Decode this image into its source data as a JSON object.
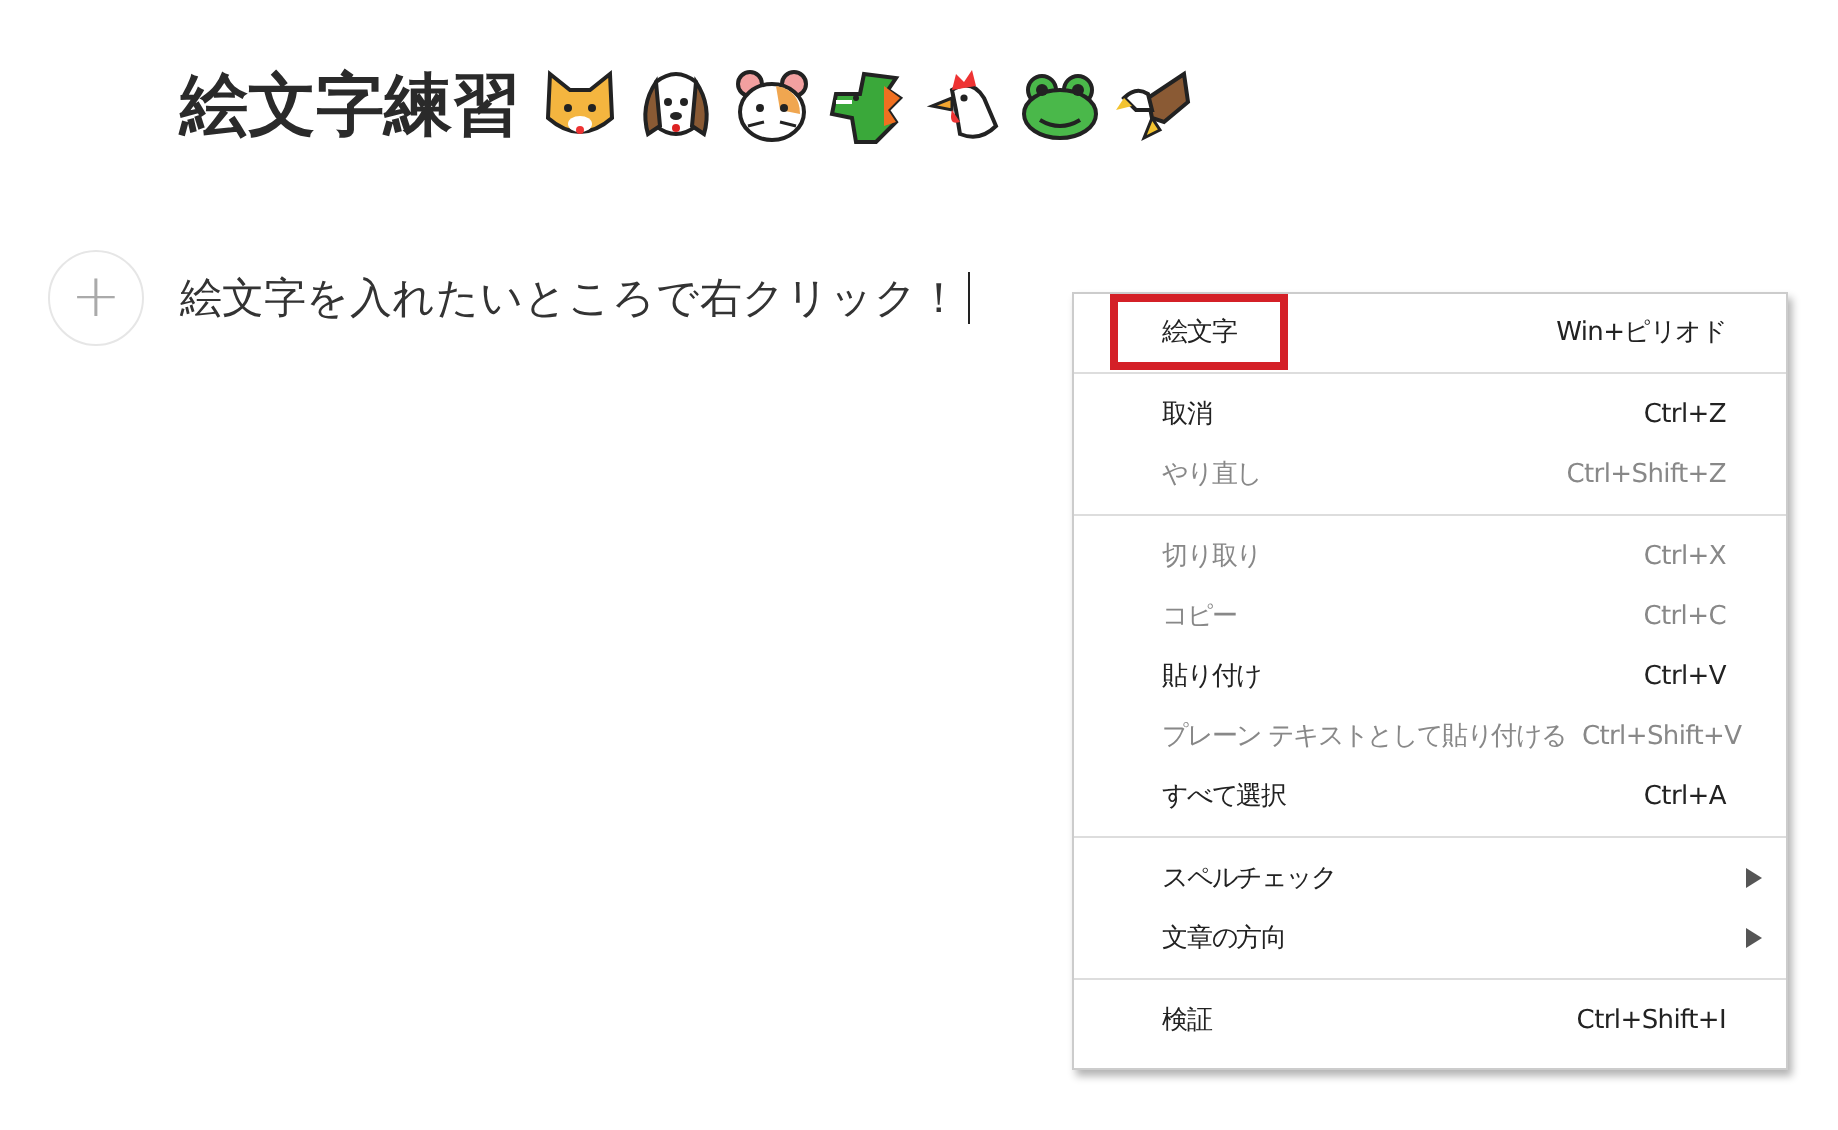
{
  "title": "絵文字練習",
  "title_emoji": [
    {
      "kind": "cat"
    },
    {
      "kind": "dog"
    },
    {
      "kind": "hamster"
    },
    {
      "kind": "dragon"
    },
    {
      "kind": "chicken"
    },
    {
      "kind": "frog"
    },
    {
      "kind": "eagle"
    }
  ],
  "add_block_button": "+",
  "body_text": "絵文字を入れたいところで右クリック！",
  "context_menu": [
    [
      {
        "label": "絵文字",
        "shortcut": "Win+ピリオド",
        "disabled": false,
        "highlighted": true,
        "submenu": false
      }
    ],
    [
      {
        "label": "取消",
        "shortcut": "Ctrl+Z",
        "disabled": false,
        "highlighted": false,
        "submenu": false
      },
      {
        "label": "やり直し",
        "shortcut": "Ctrl+Shift+Z",
        "disabled": true,
        "highlighted": false,
        "submenu": false
      }
    ],
    [
      {
        "label": "切り取り",
        "shortcut": "Ctrl+X",
        "disabled": true,
        "highlighted": false,
        "submenu": false
      },
      {
        "label": "コピー",
        "shortcut": "Ctrl+C",
        "disabled": true,
        "highlighted": false,
        "submenu": false
      },
      {
        "label": "貼り付け",
        "shortcut": "Ctrl+V",
        "disabled": false,
        "highlighted": false,
        "submenu": false
      },
      {
        "label": "プレーン テキストとして貼り付ける",
        "shortcut": "Ctrl+Shift+V",
        "disabled": true,
        "highlighted": false,
        "submenu": false
      },
      {
        "label": "すべて選択",
        "shortcut": "Ctrl+A",
        "disabled": false,
        "highlighted": false,
        "submenu": false
      }
    ],
    [
      {
        "label": "スペルチェック",
        "disabled": false,
        "highlighted": false,
        "submenu": true
      },
      {
        "label": "文章の方向",
        "disabled": false,
        "highlighted": false,
        "submenu": true
      }
    ],
    [
      {
        "label": "検証",
        "shortcut": "Ctrl+Shift+I",
        "disabled": false,
        "highlighted": false,
        "submenu": false
      }
    ]
  ]
}
